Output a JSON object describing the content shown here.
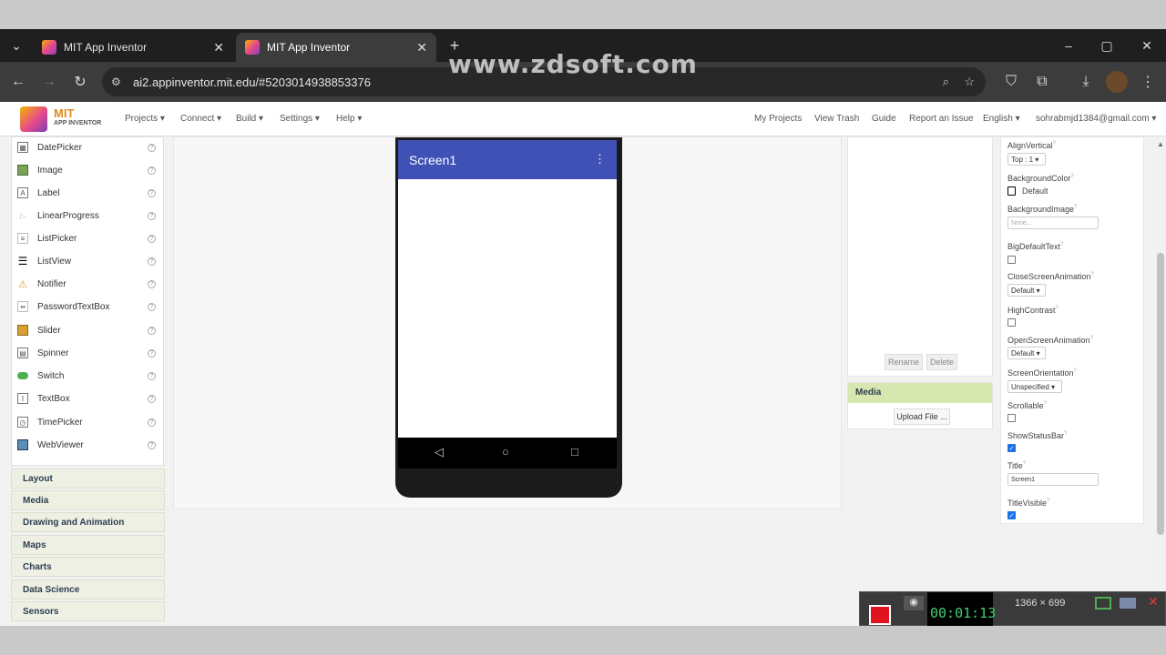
{
  "browser": {
    "tabs": [
      {
        "title": "MIT App Inventor",
        "active": false
      },
      {
        "title": "MIT App Inventor",
        "active": true
      }
    ],
    "new_tab": "+",
    "window_controls": [
      "–",
      "▢",
      "✕"
    ],
    "url": "ai2.appinventor.mit.edu/#5203014938853376",
    "watermark": "www.zdsoft.com"
  },
  "app": {
    "logo_top": "MIT",
    "logo_bottom": "APP INVENTOR",
    "menus": [
      "Projects ▾",
      "Connect ▾",
      "Build ▾",
      "Settings ▾",
      "Help ▾"
    ],
    "right_links": [
      "My Projects",
      "View Trash",
      "Guide",
      "Report an Issue",
      "English ▾",
      "sohrabmjd1384@gmail.com ▾"
    ]
  },
  "palette": {
    "items": [
      {
        "label": "DatePicker",
        "icon": "calendar-icon"
      },
      {
        "label": "Image",
        "icon": "image-icon"
      },
      {
        "label": "Label",
        "icon": "label-icon"
      },
      {
        "label": "LinearProgress",
        "icon": "progress-icon"
      },
      {
        "label": "ListPicker",
        "icon": "listpicker-icon"
      },
      {
        "label": "ListView",
        "icon": "listview-icon"
      },
      {
        "label": "Notifier",
        "icon": "warning-icon"
      },
      {
        "label": "PasswordTextBox",
        "icon": "password-icon"
      },
      {
        "label": "Slider",
        "icon": "slider-icon"
      },
      {
        "label": "Spinner",
        "icon": "spinner-icon"
      },
      {
        "label": "Switch",
        "icon": "switch-icon"
      },
      {
        "label": "TextBox",
        "icon": "textbox-icon"
      },
      {
        "label": "TimePicker",
        "icon": "clock-icon"
      },
      {
        "label": "WebViewer",
        "icon": "globe-icon"
      }
    ],
    "categories": [
      "Layout",
      "Media",
      "Drawing and Animation",
      "Maps",
      "Charts",
      "Data Science",
      "Sensors"
    ]
  },
  "viewer": {
    "screen_title": "Screen1",
    "nav_buttons": [
      "◁",
      "○",
      "□"
    ]
  },
  "components": {
    "rename": "Rename",
    "delete": "Delete"
  },
  "media": {
    "header": "Media",
    "upload": "Upload File ..."
  },
  "properties": {
    "AlignVertical": {
      "label": "AlignVertical",
      "value": "Top : 1 ▾"
    },
    "BackgroundColor": {
      "label": "BackgroundColor",
      "value": "Default"
    },
    "BackgroundImage": {
      "label": "BackgroundImage",
      "value": "None..."
    },
    "BigDefaultText": {
      "label": "BigDefaultText",
      "checked": false
    },
    "CloseScreenAnimation": {
      "label": "CloseScreenAnimation",
      "value": "Default ▾"
    },
    "HighContrast": {
      "label": "HighContrast",
      "checked": false
    },
    "OpenScreenAnimation": {
      "label": "OpenScreenAnimation",
      "value": "Default ▾"
    },
    "ScreenOrientation": {
      "label": "ScreenOrientation",
      "value": "Unspecified ▾"
    },
    "Scrollable": {
      "label": "Scrollable",
      "checked": false
    },
    "ShowStatusBar": {
      "label": "ShowStatusBar",
      "checked": true
    },
    "Title": {
      "label": "Title",
      "value": "Screen1"
    },
    "TitleVisible": {
      "label": "TitleVisible",
      "checked": true
    }
  },
  "recorder": {
    "resolution": "1366 × 699",
    "timer": "00:01:13"
  },
  "colors": {
    "screen_bar": "#3f51b5",
    "media_header": "#d8e6b0",
    "category_bg": "#eef0e3",
    "checkbox_on": "#1a73e8"
  }
}
